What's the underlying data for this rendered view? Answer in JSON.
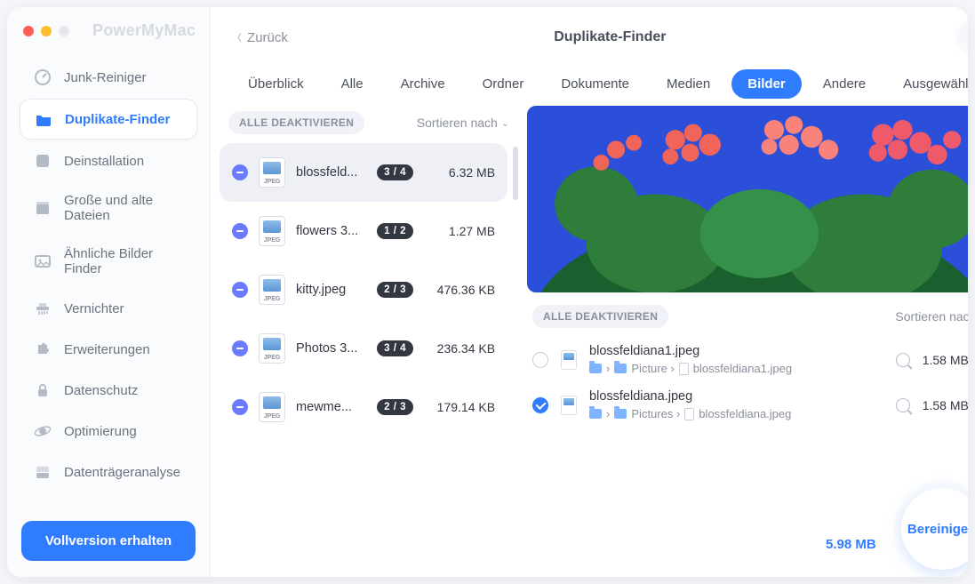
{
  "brand": "PowerMyMac",
  "back_label": "Zurück",
  "window_title": "Duplikate-Finder",
  "help_label": "?",
  "sidebar": [
    {
      "label": "Junk-Reiniger",
      "icon": "gauge"
    },
    {
      "label": "Duplikate-Finder",
      "icon": "folder",
      "active": true
    },
    {
      "label": "Deinstallation",
      "icon": "app"
    },
    {
      "label": "Große und alte Dateien",
      "icon": "box"
    },
    {
      "label": "Ähnliche Bilder Finder",
      "icon": "image"
    },
    {
      "label": "Vernichter",
      "icon": "shredder"
    },
    {
      "label": "Erweiterungen",
      "icon": "puzzle"
    },
    {
      "label": "Datenschutz",
      "icon": "lock"
    },
    {
      "label": "Optimierung",
      "icon": "orbit"
    },
    {
      "label": "Datenträgeranalyse",
      "icon": "disk"
    }
  ],
  "upgrade_label": "Vollversion erhalten",
  "tabs": [
    "Überblick",
    "Alle",
    "Archive",
    "Ordner",
    "Dokumente",
    "Medien",
    "Bilder",
    "Andere",
    "Ausgewählt"
  ],
  "active_tab": 6,
  "deactivate_all": "ALLE DEAKTIVIEREN",
  "sort_by": "Sortieren nach",
  "groups": [
    {
      "name": "blossfeld...",
      "badge": "3 / 4",
      "size": "6.32 MB",
      "selected": true
    },
    {
      "name": "flowers 3...",
      "badge": "1 / 2",
      "size": "1.27 MB"
    },
    {
      "name": "kitty.jpeg",
      "badge": "2 / 3",
      "size": "476.36 KB"
    },
    {
      "name": "Photos 3...",
      "badge": "3 / 4",
      "size": "236.34 KB"
    },
    {
      "name": "mewme...",
      "badge": "2 / 3",
      "size": "179.14 KB"
    }
  ],
  "file_ext": "JPEG",
  "details": [
    {
      "name": "blossfeldiana1.jpeg",
      "path_folder": "Picture",
      "path_file": "blossfeldiana1.jpeg",
      "size": "1.58 MB",
      "checked": false
    },
    {
      "name": "blossfeldiana.jpeg",
      "path_folder": "Pictures",
      "path_file": "blossfeldiana.jpeg",
      "size": "1.58 MB",
      "checked": true
    }
  ],
  "path_sep": "›",
  "selected_total": "5.98 MB",
  "clean_label": "Bereinigen"
}
